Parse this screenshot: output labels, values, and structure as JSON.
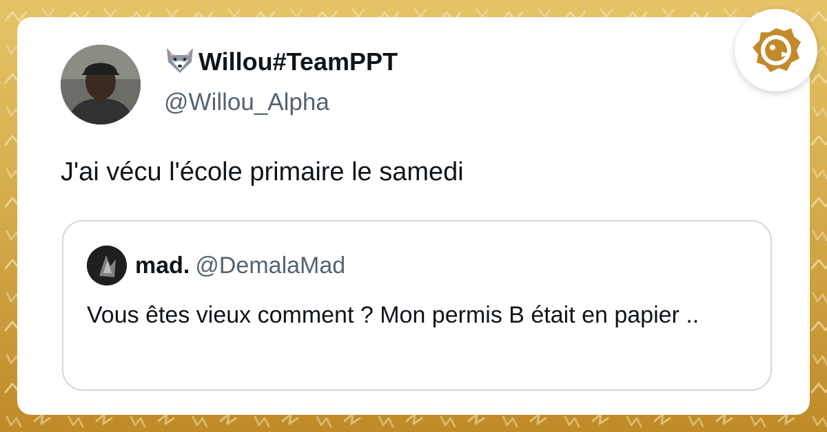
{
  "colors": {
    "background_gold": "#c7962f",
    "background_light_gold": "#e0bd5e",
    "card": "#ffffff",
    "primary_text": "#0f1419",
    "secondary_text": "#536471",
    "quote_border": "#cfd9de",
    "badge_gold": "#c38a2c"
  },
  "tweet": {
    "display_name": "Willou#TeamPPT",
    "name_emoji_icon": "wolf-icon",
    "handle": "@Willou_Alpha",
    "text": "J'ai vécu l'école primaire le samedi"
  },
  "quoted_tweet": {
    "display_name": "mad.",
    "handle": "@DemalaMad",
    "text": "Vous êtes vieux comment ? Mon permis B était en papier .."
  },
  "badge": {
    "icon": "brand-logo-icon"
  }
}
